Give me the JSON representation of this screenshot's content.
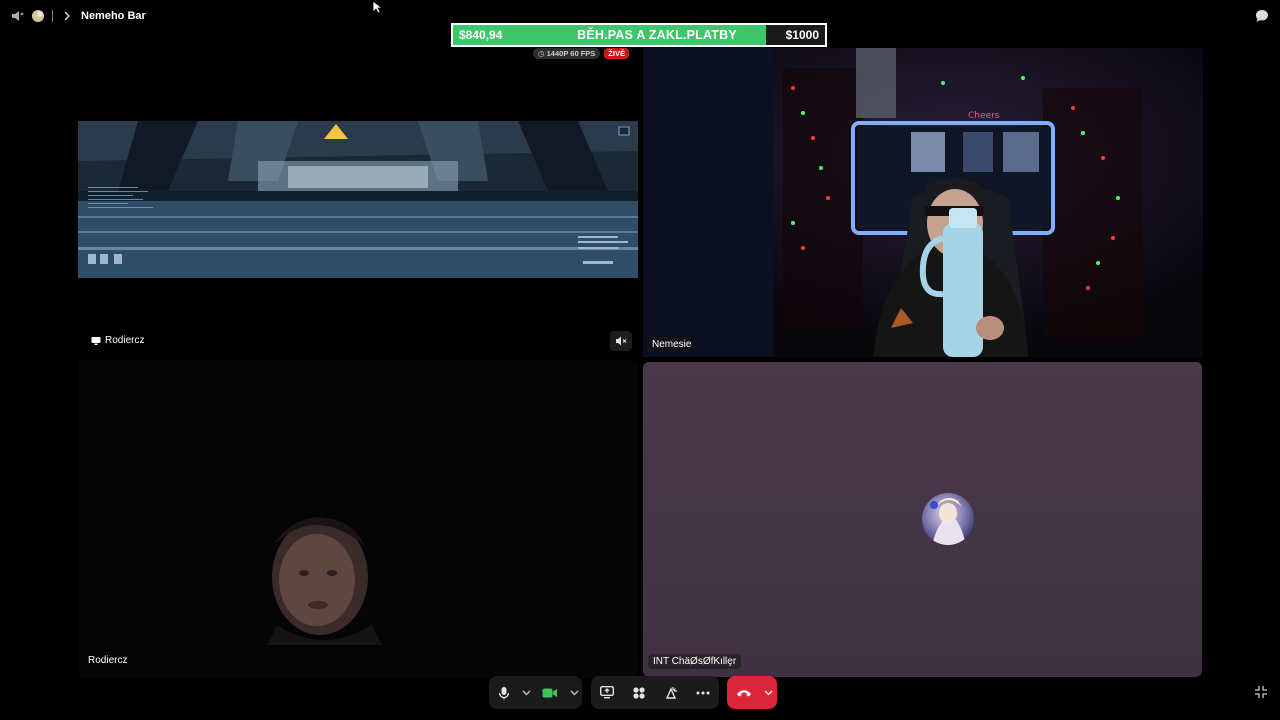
{
  "topbar": {
    "title": "Nemeho Bar"
  },
  "goal": {
    "current": "$840,94",
    "label": "BĚH.PAS A ZAKL.PLATBY",
    "target": "$1000",
    "progress": 0.84094,
    "fill_color": "#3fc66a"
  },
  "stream": {
    "quality": "1440P 60 FPS",
    "live": "ŽIVĚ"
  },
  "tiles": {
    "screen_share_label": "Rodiercz",
    "rodiercz_label": "Rodiercz",
    "nemesie_label": "Nemesie",
    "chaos_label": "INT ChäØsØfKıllȩr"
  },
  "controls": {
    "accent_hangup": "#d9263a",
    "accent_camera": "#3ec45c"
  }
}
